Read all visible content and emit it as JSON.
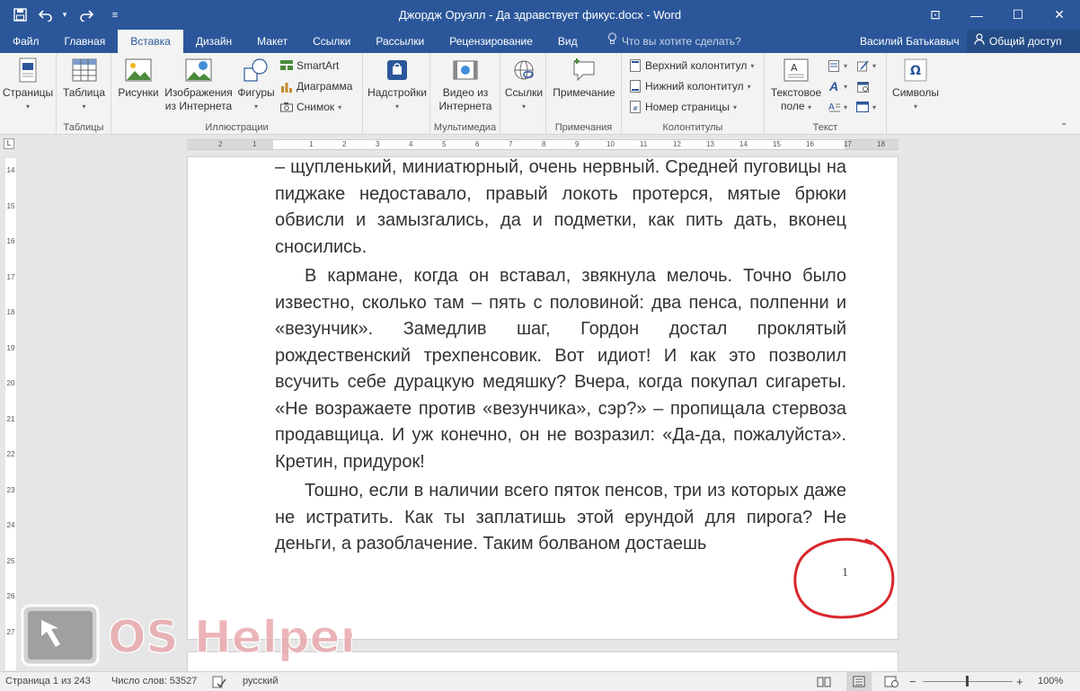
{
  "titlebar": {
    "title": "Джордж Оруэлл - Да здравствует фикус.docx - Word",
    "save_icon": "save-icon",
    "undo_icon": "undo-icon",
    "redo_icon": "redo-icon",
    "controls": {
      "ribbon_display": "⊡",
      "minimize": "—",
      "maximize": "☐",
      "close": "✕"
    }
  },
  "menu": {
    "tabs": [
      "Файл",
      "Главная",
      "Вставка",
      "Дизайн",
      "Макет",
      "Ссылки",
      "Рассылки",
      "Рецензирование",
      "Вид"
    ],
    "active_tab": "Вставка",
    "tell_me": "Что вы хотите сделать?",
    "user": "Василий Батькавыч",
    "share": "Общий доступ"
  },
  "ribbon": {
    "pages": {
      "label": "Страницы"
    },
    "tables": {
      "button": "Таблица",
      "group": "Таблицы"
    },
    "illustrations": {
      "pictures": "Рисунки",
      "online_pictures_1": "Изображения",
      "online_pictures_2": "из Интернета",
      "shapes": "Фигуры",
      "smartart": "SmartArt",
      "chart": "Диаграмма",
      "screenshot": "Снимок",
      "group": "Иллюстрации"
    },
    "addins": {
      "button": "Надстройки"
    },
    "media": {
      "video_1": "Видео из",
      "video_2": "Интернета",
      "group": "Мультимедиа"
    },
    "links": {
      "button": "Ссылки"
    },
    "comments": {
      "button": "Примечание",
      "group": "Примечания"
    },
    "header_footer": {
      "header": "Верхний колонтитул",
      "footer": "Нижний колонтитул",
      "page_number": "Номер страницы",
      "group": "Колонтитулы"
    },
    "text": {
      "textbox_1": "Текстовое",
      "textbox_2": "поле",
      "group": "Текст"
    },
    "symbols": {
      "button": "Символы"
    }
  },
  "ruler": {
    "h_numbers": [
      "2",
      "1",
      "1",
      "2",
      "3",
      "4",
      "5",
      "6",
      "7",
      "8",
      "9",
      "10",
      "11",
      "12",
      "13",
      "14",
      "15",
      "16",
      "17",
      "18"
    ],
    "v_numbers": [
      "14",
      "15",
      "16",
      "17",
      "18",
      "19",
      "20",
      "21",
      "22",
      "23",
      "24",
      "25",
      "26",
      "27"
    ],
    "corner": "L"
  },
  "document": {
    "paragraphs": [
      "– щупленький, миниатюрный, очень нервный. Средней пуговицы на пиджаке недоставало, правый локоть протерся, мятые брюки обвисли и замызгались, да и подметки, как пить дать, вконец сносились.",
      "В кармане, когда он вставал, звякнула мелочь. Точно было известно, сколько там – пять с половиной: два пенса, полпенни и «везунчик». Замедлив шаг, Гордон достал проклятый рождественский трехпенсовик. Вот идиот! И как это позволил всучить себе дурацкую медяшку? Вчера, когда покупал сигареты. «Не возражаете против «везунчика», сэр?» – пропищала стервоза продавщица. И уж конечно, он не возразил: «Да-да, пожалуйста». Кретин, придурок!",
      "Тошно, если в наличии всего пяток пенсов, три из которых даже не истратить. Как ты заплатишь этой ерундой для пирога? Не деньги, а разоблачение. Таким болваном достаешь"
    ],
    "page_number": "1",
    "annotation_color": "#d9262b"
  },
  "watermark": {
    "text": "OS Helper"
  },
  "status": {
    "page": "Страница 1 из 243",
    "words": "Число слов: 53527",
    "language": "русский",
    "zoom": "100%",
    "zoom_minus": "−",
    "zoom_plus": "+"
  },
  "colors": {
    "accent": "#2b579a",
    "ribbon_bg": "#f3f3f3"
  }
}
